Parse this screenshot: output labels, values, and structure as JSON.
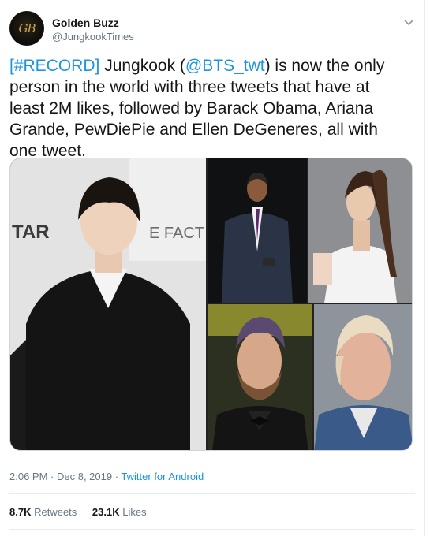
{
  "author": {
    "display_name": "Golden Buzz",
    "handle": "@JungkookTimes",
    "avatar_monogram": "GB",
    "icon": "chevron-down-icon"
  },
  "tweet": {
    "hashtag": "[#RECORD]",
    "mention": "@BTS_twt",
    "text_part1": " Jungkook (",
    "text_part2": ") is now the only person in the world with three tweets that have at least 2M likes, followed by Barack Obama, Ariana Grande, PewDiePie and Ellen DeGeneres, all with one tweet."
  },
  "media": {
    "backdrop_text_1": "TAR",
    "backdrop_text_2": "E FACT"
  },
  "meta": {
    "time": "2:06 PM",
    "separator_1": " · ",
    "date": "Dec 8, 2019",
    "separator_2": " · ",
    "source": "Twitter for Android"
  },
  "stats": {
    "retweets_count": "8.7K",
    "retweets_label": "Retweets",
    "likes_count": "23.1K",
    "likes_label": "Likes"
  },
  "colors": {
    "link": "#1b95e0",
    "text": "#14171a",
    "muted": "#657786"
  }
}
